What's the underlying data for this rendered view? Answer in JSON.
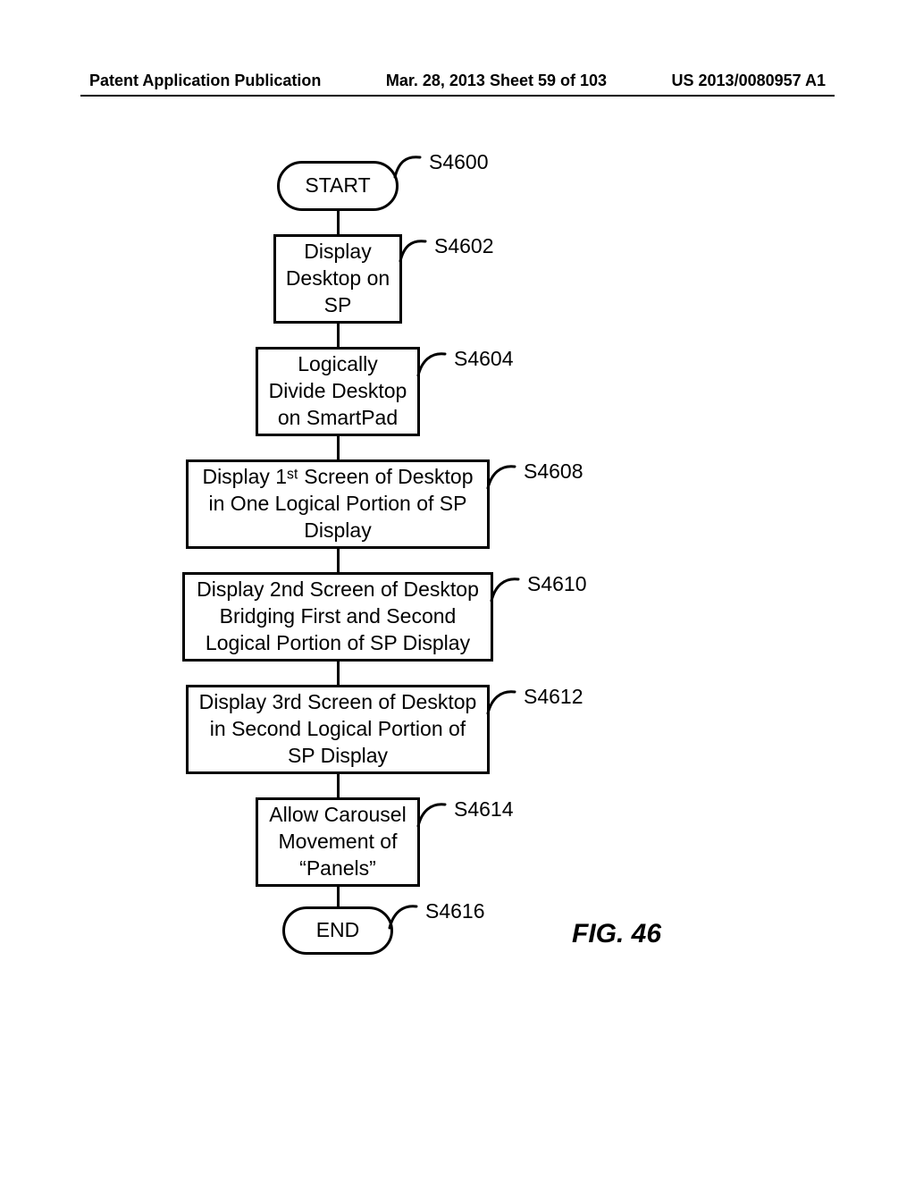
{
  "header": {
    "left": "Patent Application Publication",
    "center": "Mar. 28, 2013  Sheet 59 of 103",
    "right": "US 2013/0080957 A1"
  },
  "nodes": {
    "start": "START",
    "s4602": "Display Desktop on SP",
    "s4604": "Logically Divide Desktop on SmartPad",
    "s4608": "Display 1ˢᵗ Screen of Desktop in One Logical Portion of SP Display",
    "s4610": "Display 2nd Screen of Desktop Bridging First and Second Logical Portion of SP Display",
    "s4612": "Display 3rd Screen of Desktop in Second Logical Portion of SP Display",
    "s4614": "Allow Carousel Movement of “Panels”",
    "end": "END"
  },
  "labels": {
    "s4600": "S4600",
    "s4602": "S4602",
    "s4604": "S4604",
    "s4608": "S4608",
    "s4610": "S4610",
    "s4612": "S4612",
    "s4614": "S4614",
    "s4616": "S4616"
  },
  "figure_caption": "FIG. 46"
}
